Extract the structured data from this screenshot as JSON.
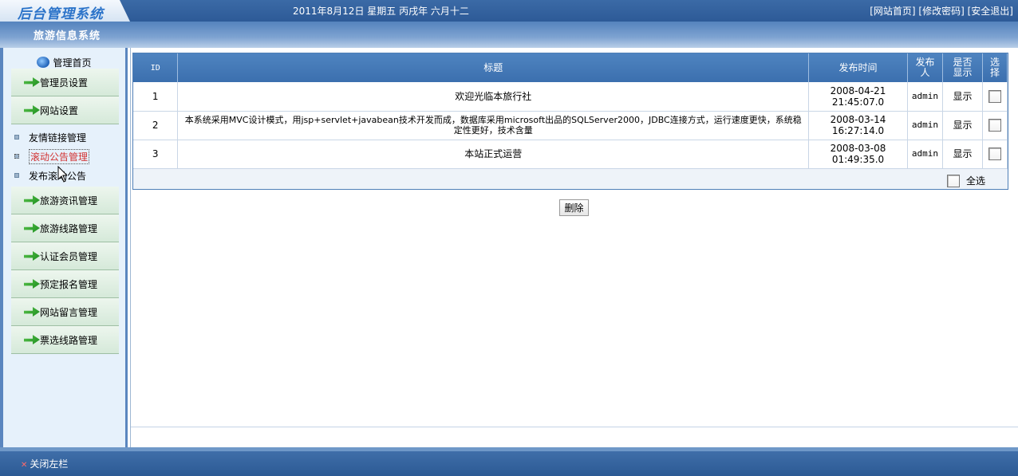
{
  "header": {
    "logo_text": "后台管理系统",
    "datetime": "2011年8月12日 星期五 丙戌年 六月十二",
    "links": [
      "[网站首页]",
      "[修改密码]",
      "[安全退出]"
    ]
  },
  "system_title": "旅游信息系统",
  "sidebar": {
    "home_label": "管理首页",
    "groups": [
      {
        "label": "管理员设置"
      },
      {
        "label": "网站设置"
      }
    ],
    "sub_items": [
      {
        "label": "友情链接管理"
      },
      {
        "label": "滚动公告管理"
      },
      {
        "label": "发布滚动公告"
      }
    ],
    "groups_after": [
      {
        "label": "旅游资讯管理"
      },
      {
        "label": "旅游线路管理"
      },
      {
        "label": "认证会员管理"
      },
      {
        "label": "预定报名管理"
      },
      {
        "label": "网站留言管理"
      },
      {
        "label": "票选线路管理"
      }
    ]
  },
  "table": {
    "headers": {
      "id": "ID",
      "title": "标题",
      "time": "发布时间",
      "author": "发布人",
      "show": "是否显示",
      "select": "选择"
    },
    "rows": [
      {
        "id": "1",
        "title": "欢迎光临本旅行社",
        "date": "2008-04-21",
        "time": "21:45:07.0",
        "author": "admin",
        "show": "显示"
      },
      {
        "id": "2",
        "title": "本系统采用MVC设计模式，用jsp+servlet+javabean技术开发而成，数据库采用microsoft出品的SQLServer2000，JDBC连接方式，运行速度更快，系统稳定性更好，技术含量",
        "date": "2008-03-14",
        "time": "16:27:14.0",
        "author": "admin",
        "show": "显示"
      },
      {
        "id": "3",
        "title": "本站正式运营",
        "date": "2008-03-08",
        "time": "01:49:35.0",
        "author": "admin",
        "show": "显示"
      }
    ],
    "select_all_label": "全选"
  },
  "delete_label": "删除",
  "footer": {
    "close_left_label": "关闭左栏"
  }
}
